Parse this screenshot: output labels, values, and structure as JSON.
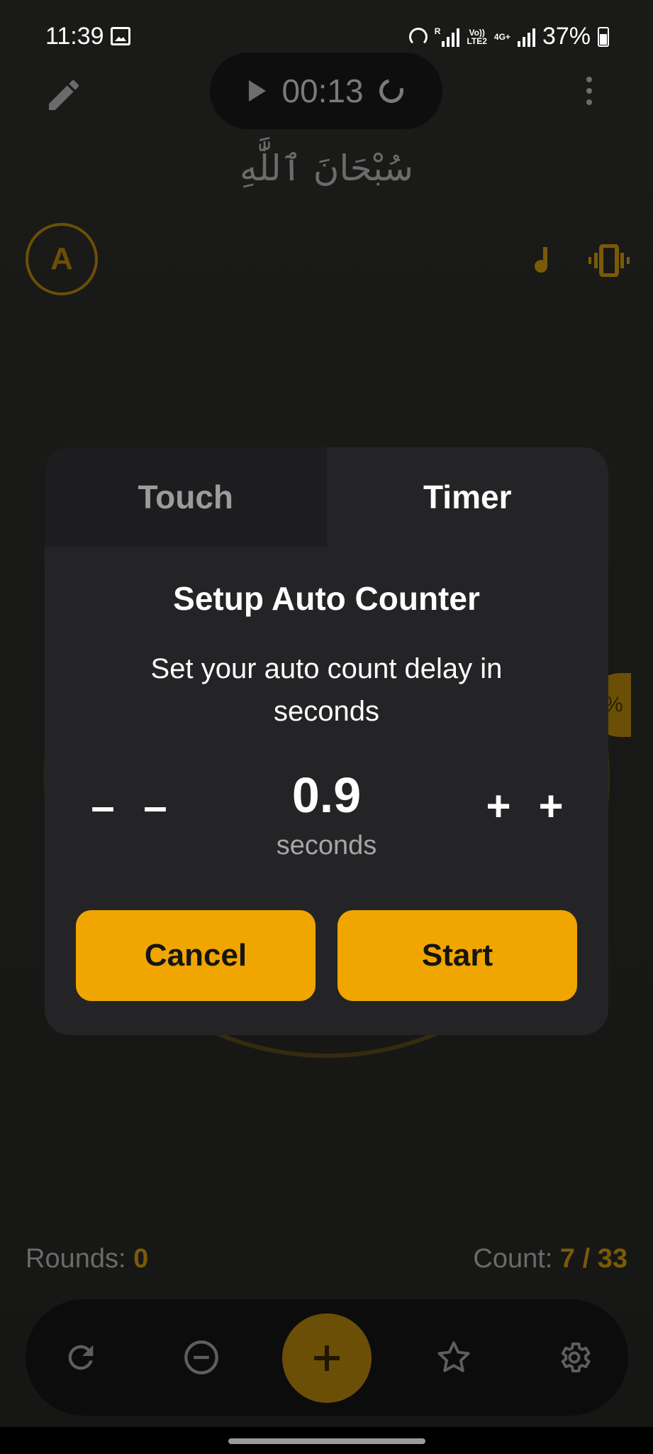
{
  "status_bar": {
    "time": "11:39",
    "net_top": "R",
    "volte_top": "Vo))",
    "volte_bottom": "LTE2",
    "net_type": "4G+",
    "battery": "37%"
  },
  "top_bar": {
    "timer": "00:13"
  },
  "dhikr_text": "سُبْحَانَ ٱللَّٰهِ",
  "avatar_letter": "A",
  "dialog": {
    "tabs": [
      {
        "label": "Touch",
        "active": false
      },
      {
        "label": "Timer",
        "active": true
      }
    ],
    "title": "Setup Auto Counter",
    "subtitle": "Set your auto count delay in seconds",
    "decrease_label": "–",
    "increase_label": "+",
    "value": "0.9",
    "unit": "seconds",
    "cancel_label": "Cancel",
    "start_label": "Start"
  },
  "bottom": {
    "rounds_label": "Rounds:",
    "rounds_value": "0",
    "count_label": "Count:",
    "count_value": "7 / 33"
  },
  "colors": {
    "accent": "#f0a500",
    "accent_dimmed": "#6b4f06",
    "dialog_bg": "#242426"
  }
}
